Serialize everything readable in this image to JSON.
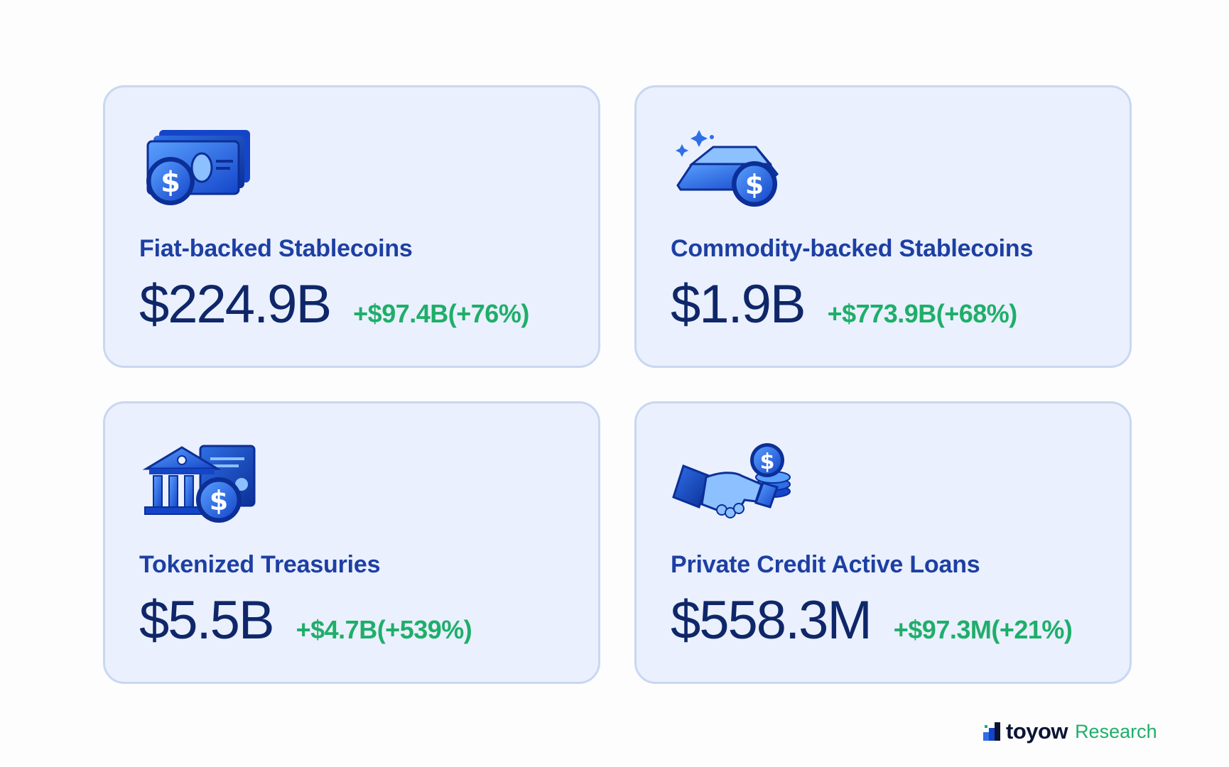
{
  "cards": [
    {
      "title": "Fiat-backed Stablecoins",
      "value": "$224.9B",
      "change": "+$97.4B(+76%)",
      "icon": "cash-coin-icon"
    },
    {
      "title": "Commodity-backed Stablecoins",
      "value": "$1.9B",
      "change": "+$773.9B(+68%)",
      "icon": "gold-bar-coin-icon"
    },
    {
      "title": "Tokenized Treasuries",
      "value": "$5.5B",
      "change": "+$4.7B(+539%)",
      "icon": "bank-certificate-coin-icon"
    },
    {
      "title": "Private Credit Active Loans",
      "value": "$558.3M",
      "change": "+$97.3M(+21%)",
      "icon": "handshake-coin-icon"
    }
  ],
  "brand": {
    "name": "toyow",
    "suffix": "Research"
  },
  "colors": {
    "card_background": "#eaf0fd",
    "card_border": "#c9d7f1",
    "title": "#1d3fa3",
    "value": "#0f2769",
    "change": "#1fae6a",
    "icon_blue": "#2f6fe6"
  }
}
